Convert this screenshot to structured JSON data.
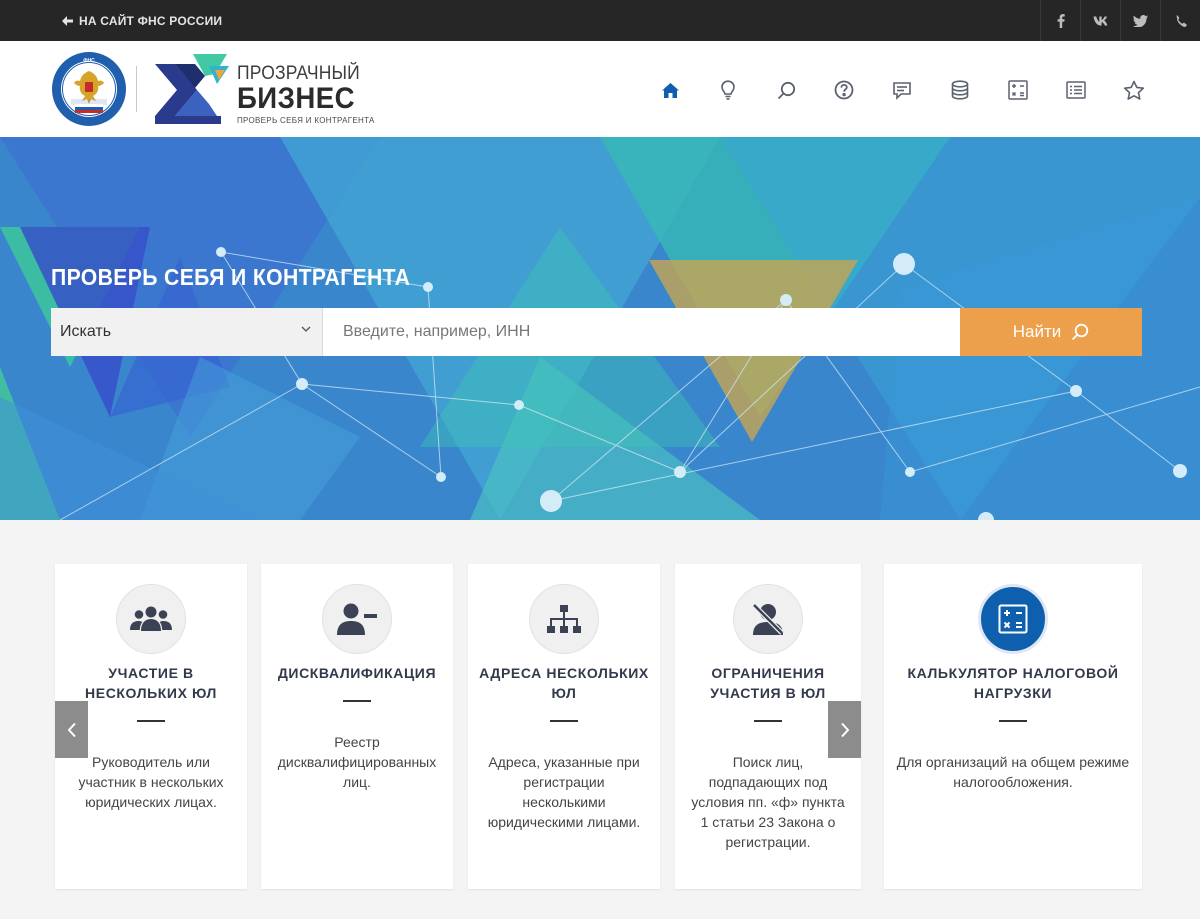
{
  "topbar": {
    "back_link": "НА САЙТ ФНС РОССИИ",
    "social": [
      {
        "icon": "facebook-icon"
      },
      {
        "icon": "vk-icon"
      },
      {
        "icon": "twitter-icon"
      },
      {
        "icon": "phone-icon"
      }
    ]
  },
  "header": {
    "brand": {
      "line1": "ПРОЗРАЧНЫЙ",
      "line2": "БИЗНЕС",
      "tagline": "ПРОВЕРЬ СЕБЯ И КОНТРАГЕНТА"
    },
    "emblem_text": "ФЕДЕРАЛЬНАЯ НАЛОГОВАЯ СЛУЖБА",
    "nav": [
      "home-icon",
      "lightbulb-icon",
      "search-icon",
      "help-icon",
      "chat-icon",
      "database-icon",
      "calculator-icon",
      "list-icon",
      "star-icon"
    ],
    "active_color": "#0e5fae"
  },
  "hero": {
    "title": "ПРОВЕРЬ СЕБЯ И КОНТРАГЕНТА",
    "search": {
      "select_value": "Искать",
      "placeholder": "Введите, например, ИНН",
      "button": "Найти"
    },
    "button_color": "#eda04c"
  },
  "cards": [
    {
      "icon": "people-group-icon",
      "title": "УЧАСТИЕ В НЕСКОЛЬКИХ ЮЛ",
      "desc": "Руководитель или участник в нескольких юридических лицах."
    },
    {
      "icon": "user-minus-icon",
      "title": "ДИСКВАЛИФИКАЦИЯ",
      "desc": "Реестр дисквалифицированных лиц."
    },
    {
      "icon": "hierarchy-icon",
      "title": "АДРЕСА НЕСКОЛЬКИХ ЮЛ",
      "desc": "Адреса, указанные при регистрации несколькими юридическими лицами."
    },
    {
      "icon": "user-slash-icon",
      "title": "ОГРАНИЧЕНИЯ УЧАСТИЯ В ЮЛ",
      "desc": "Поиск лиц, подпадающих под условия пп. «ф» пункта 1 статьи 23 Закона о регистрации."
    },
    {
      "icon": "calculator-icon",
      "title": "КАЛЬКУЛЯТОР НАЛОГОВОЙ НАГРУЗКИ",
      "desc": "Для организаций на общем режиме налогообложения."
    }
  ]
}
